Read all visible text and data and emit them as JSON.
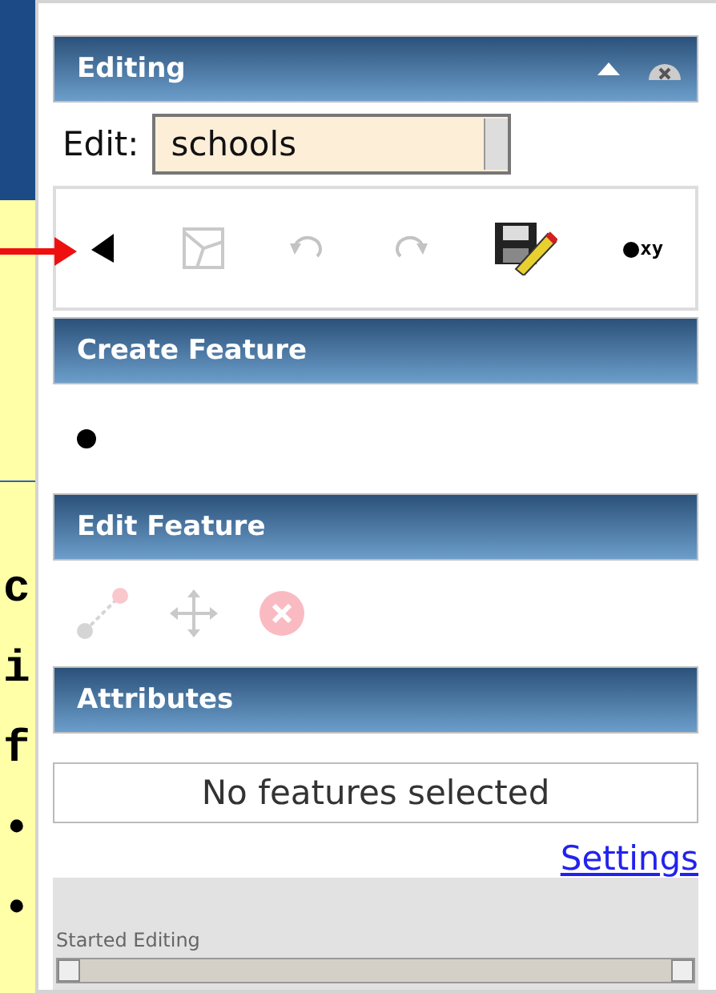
{
  "slide": {
    "fragments": [
      "c",
      "i",
      "f",
      "•",
      "•"
    ]
  },
  "panel": {
    "title": "Editing",
    "edit_label": "Edit:",
    "layer": "schools",
    "tools": [
      {
        "kind": "select",
        "disabled": false
      },
      {
        "kind": "reshape",
        "disabled": true
      },
      {
        "kind": "undo",
        "disabled": true
      },
      {
        "kind": "redo",
        "disabled": true
      },
      {
        "kind": "save",
        "disabled": false
      },
      {
        "kind": "xy",
        "disabled": false,
        "label": "xy"
      }
    ],
    "create_title": "Create Feature",
    "create_tools": [
      {
        "kind": "point",
        "disabled": false
      }
    ],
    "edit_title": "Edit Feature",
    "edit_tools": [
      {
        "kind": "vertex",
        "disabled": true
      },
      {
        "kind": "move",
        "disabled": true
      },
      {
        "kind": "delete",
        "disabled": true
      }
    ],
    "attributes_title": "Attributes",
    "attributes_message": "No features selected",
    "settings_link": "Settings",
    "status": "Started Editing"
  }
}
